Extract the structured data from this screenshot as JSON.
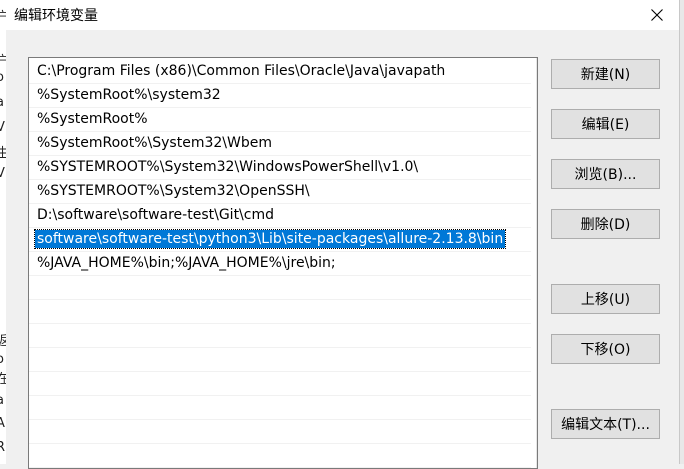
{
  "dialog": {
    "title": "编辑环境变量"
  },
  "background_fragments": [
    "户",
    "o",
    "户",
    "a",
    "V",
    "生",
    "V",
    "返",
    "o",
    "在",
    "a",
    "A",
    "R"
  ],
  "path_list": [
    {
      "value": "C:\\Program Files (x86)\\Common Files\\Oracle\\Java\\javapath",
      "selected": false
    },
    {
      "value": "%SystemRoot%\\system32",
      "selected": false
    },
    {
      "value": "%SystemRoot%",
      "selected": false
    },
    {
      "value": "%SystemRoot%\\System32\\Wbem",
      "selected": false
    },
    {
      "value": "%SYSTEMROOT%\\System32\\WindowsPowerShell\\v1.0\\",
      "selected": false
    },
    {
      "value": "%SYSTEMROOT%\\System32\\OpenSSH\\",
      "selected": false
    },
    {
      "value": "D:\\software\\software-test\\Git\\cmd",
      "selected": false
    },
    {
      "value": "software\\software-test\\python3\\Lib\\site-packages\\allure-2.13.8\\bin",
      "selected": true
    },
    {
      "value": "%JAVA_HOME%\\bin;%JAVA_HOME%\\jre\\bin;",
      "selected": false
    }
  ],
  "buttons": {
    "new": "新建(N)",
    "edit": "编辑(E)",
    "browse": "浏览(B)...",
    "delete": "删除(D)",
    "move_up": "上移(U)",
    "move_down": "下移(O)",
    "edit_text": "编辑文本(T)..."
  },
  "colors": {
    "selection": "#0078d7",
    "dialog_bg": "#f0f0f0",
    "button_bg": "#e1e1e1"
  }
}
